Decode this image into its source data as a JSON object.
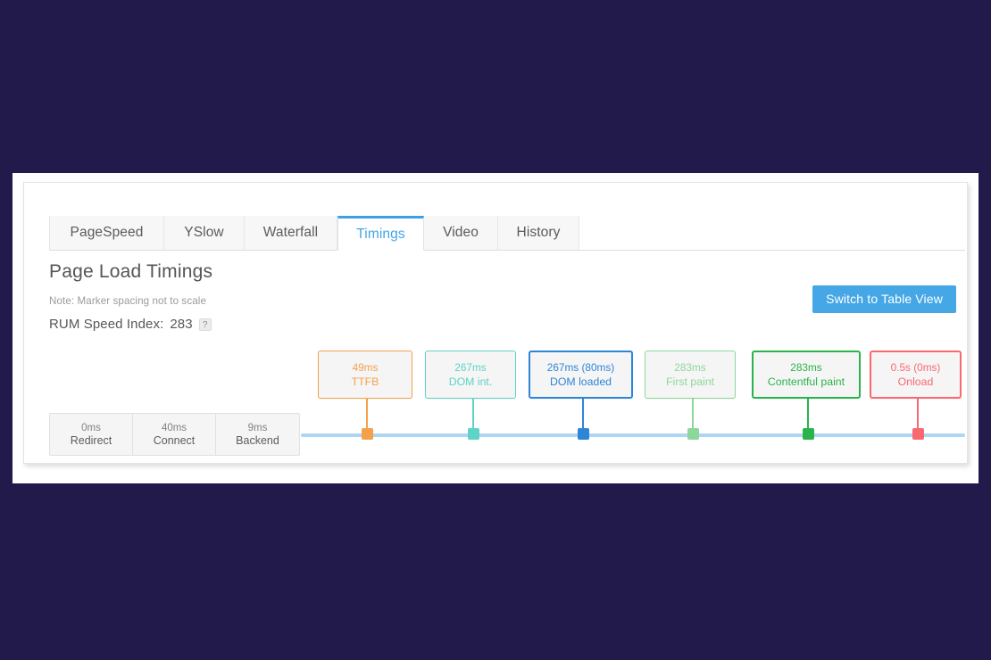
{
  "app": {
    "background_color": "#231a4c",
    "card_background": "#ffffff"
  },
  "tabs": [
    {
      "label": "PageSpeed",
      "active": false
    },
    {
      "label": "YSlow",
      "active": false
    },
    {
      "label": "Waterfall",
      "active": false
    },
    {
      "label": "Timings",
      "active": true
    },
    {
      "label": "Video",
      "active": false
    },
    {
      "label": "History",
      "active": false
    }
  ],
  "header": {
    "title": "Page Load Timings",
    "note": "Note: Marker spacing not to scale",
    "rum_label": "RUM Speed Index:",
    "rum_value": "283",
    "help_icon": "question-mark-icon",
    "help_glyph": "?"
  },
  "toolbar": {
    "switch_view_label": "Switch to Table View",
    "switch_view_color": "#45a7e6"
  },
  "timeline": {
    "rail_color": "#aed5f2",
    "phases": [
      {
        "value": "0ms",
        "label": "Redirect"
      },
      {
        "value": "40ms",
        "label": "Connect"
      },
      {
        "value": "9ms",
        "label": "Backend"
      }
    ],
    "markers": [
      {
        "value": "49ms",
        "label": "TTFB",
        "color": "#f5a14b",
        "emphasis": false
      },
      {
        "value": "267ms",
        "label": "DOM int.",
        "color": "#5ed3c6",
        "emphasis": false
      },
      {
        "value": "267ms (80ms)",
        "label": "DOM loaded",
        "color": "#2d85d8",
        "emphasis": true
      },
      {
        "value": "283ms",
        "label": "First paint",
        "color": "#8ed79a",
        "emphasis": false
      },
      {
        "value": "283ms",
        "label": "Contentful paint",
        "color": "#28b44b",
        "emphasis": true
      },
      {
        "value": "0.5s (0ms)",
        "label": "Onload",
        "color": "#f9696f",
        "emphasis": true
      }
    ]
  }
}
